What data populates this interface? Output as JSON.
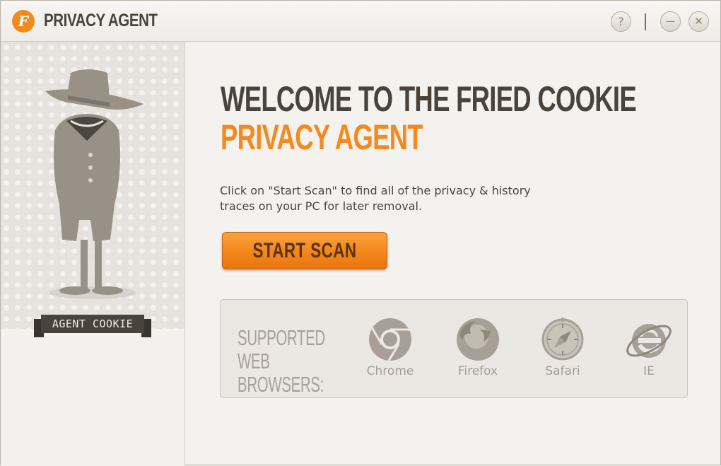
{
  "window": {
    "title": "PRIVACY AGENT",
    "logo_letter": "F",
    "help_label": "?",
    "minimize_label": "—",
    "close_label": "✕"
  },
  "sidebar": {
    "badge": "AGENT COOKIE"
  },
  "main": {
    "heading_line1": "WELCOME TO THE FRIED COOKIE",
    "heading_line2": "PRIVACY AGENT",
    "description": "Click on \"Start Scan\" to find all of the privacy & history traces on your PC for later removal.",
    "start_button": "START SCAN"
  },
  "browsers": {
    "label_line1": "SUPPORTED",
    "label_line2": "WEB BROWSERS:",
    "items": [
      {
        "name": "Chrome",
        "icon": "chrome-icon"
      },
      {
        "name": "Firefox",
        "icon": "firefox-icon"
      },
      {
        "name": "Safari",
        "icon": "safari-icon"
      },
      {
        "name": "IE",
        "icon": "ie-icon"
      }
    ]
  },
  "colors": {
    "accent": "#f28a1e",
    "heading": "#4a433b",
    "muted": "#a49c92"
  }
}
